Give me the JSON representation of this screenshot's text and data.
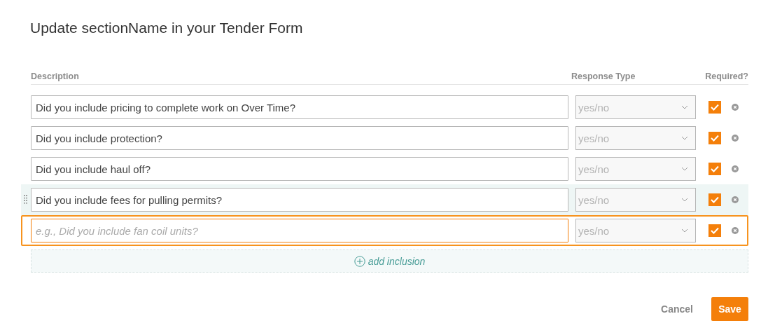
{
  "dialog": {
    "title": "Update sectionName in your Tender Form"
  },
  "table": {
    "columns": [
      "Description",
      "Response Type",
      "Required?"
    ],
    "rows": [
      {
        "description": "Did you include pricing to complete work on Over Time?",
        "response_type": "yes/no",
        "required": true,
        "hovered": false,
        "focused": false
      },
      {
        "description": "Did you include protection?",
        "response_type": "yes/no",
        "required": true,
        "hovered": false,
        "focused": false
      },
      {
        "description": "Did you include haul off?",
        "response_type": "yes/no",
        "required": true,
        "hovered": false,
        "focused": false
      },
      {
        "description": "Did you include fees for pulling permits?",
        "response_type": "yes/no",
        "required": true,
        "hovered": true,
        "focused": false
      },
      {
        "placeholder": "e.g., Did you include fan coil units?",
        "response_type": "yes/no",
        "required": true,
        "hovered": false,
        "focused": true
      }
    ]
  },
  "add_button": {
    "label": "add inclusion"
  },
  "buttons": [
    {
      "label": "Cancel",
      "kind": "link"
    },
    {
      "label": "Save",
      "kind": "primary"
    }
  ]
}
